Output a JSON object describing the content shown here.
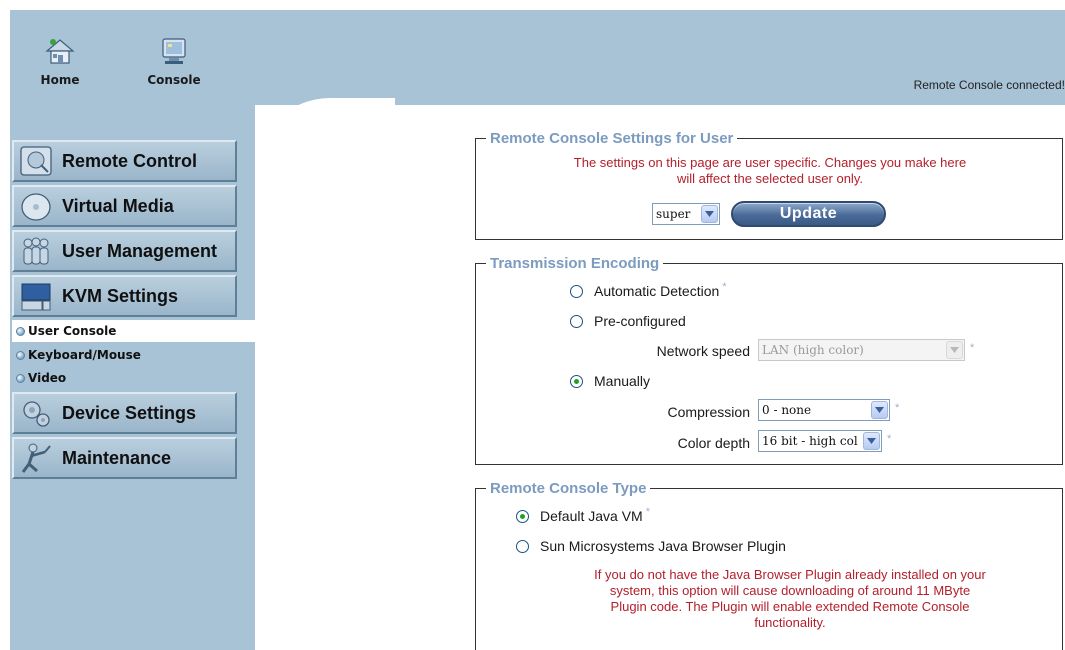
{
  "topnav": {
    "home_label": "Home",
    "console_label": "Console",
    "status": "Remote Console connected!"
  },
  "sidebar": {
    "items": [
      {
        "label": "Remote Control",
        "icon": "remote-control-icon"
      },
      {
        "label": "Virtual Media",
        "icon": "virtual-media-icon"
      },
      {
        "label": "User Management",
        "icon": "user-management-icon"
      },
      {
        "label": "KVM Settings",
        "icon": "kvm-settings-icon"
      },
      {
        "label": "Device Settings",
        "icon": "device-settings-icon"
      },
      {
        "label": "Maintenance",
        "icon": "maintenance-icon"
      }
    ],
    "subitems": [
      {
        "label": "User Console",
        "active": true
      },
      {
        "label": "Keyboard/Mouse",
        "active": false
      },
      {
        "label": "Video",
        "active": false
      }
    ]
  },
  "user_settings": {
    "legend": "Remote Console Settings for User",
    "note_line1": "The settings on this page are user specific. Changes you make here",
    "note_line2": "will affect the selected user only.",
    "user_select": "super",
    "update_label": "Update"
  },
  "encoding": {
    "legend": "Transmission Encoding",
    "auto_label": "Automatic Detection",
    "preconfigured_label": "Pre-configured",
    "network_speed_label": "Network speed",
    "network_speed_value": "LAN (high color)",
    "manual_label": "Manually",
    "compression_label": "Compression",
    "compression_value": "0 - none",
    "color_depth_label": "Color depth",
    "color_depth_value": "16 bit - high col",
    "selected": "manual",
    "star": "*"
  },
  "console_type": {
    "legend": "Remote Console Type",
    "default_label": "Default Java VM",
    "plugin_label": "Sun Microsystems Java Browser Plugin",
    "plugin_note_line1": "If you do not have the Java Browser Plugin already installed on your",
    "plugin_note_line2": "system, this option will cause downloading of around 11 MByte",
    "plugin_note_line3": "Plugin code. The Plugin will enable extended Remote Console",
    "plugin_note_line4": "functionality.",
    "selected": "default"
  },
  "colors": {
    "chrome_blue": "#a8c2d6",
    "legend_blue": "#7b9bbf",
    "warning_red": "#b3202b",
    "radio_green": "#21a121"
  }
}
